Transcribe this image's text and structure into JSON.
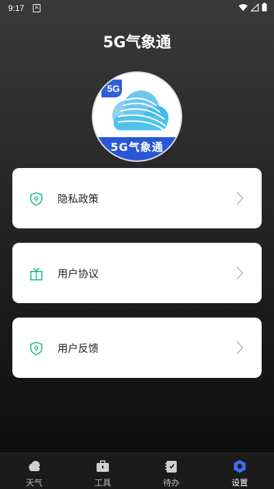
{
  "status_bar": {
    "time": "9:17",
    "app_icon_glyph": "A"
  },
  "header": {
    "title": "5G气象通"
  },
  "logo": {
    "tag_text": "5G",
    "banner_text": "5G气象通"
  },
  "menu": [
    {
      "label": "隐私政策",
      "icon": "shield-icon"
    },
    {
      "label": "用户协议",
      "icon": "gift-box-icon"
    },
    {
      "label": "用户反馈",
      "icon": "shield-icon"
    }
  ],
  "tabs": [
    {
      "label": "天气",
      "icon": "cloud-icon",
      "active": false
    },
    {
      "label": "工具",
      "icon": "toolbox-icon",
      "active": false
    },
    {
      "label": "待办",
      "icon": "todo-icon",
      "active": false
    },
    {
      "label": "设置",
      "icon": "settings-hex-icon",
      "active": true
    }
  ],
  "colors": {
    "accent": "#1db88e",
    "active_tab": "#3b6ff0",
    "logo_blue": "#2a57d6"
  }
}
